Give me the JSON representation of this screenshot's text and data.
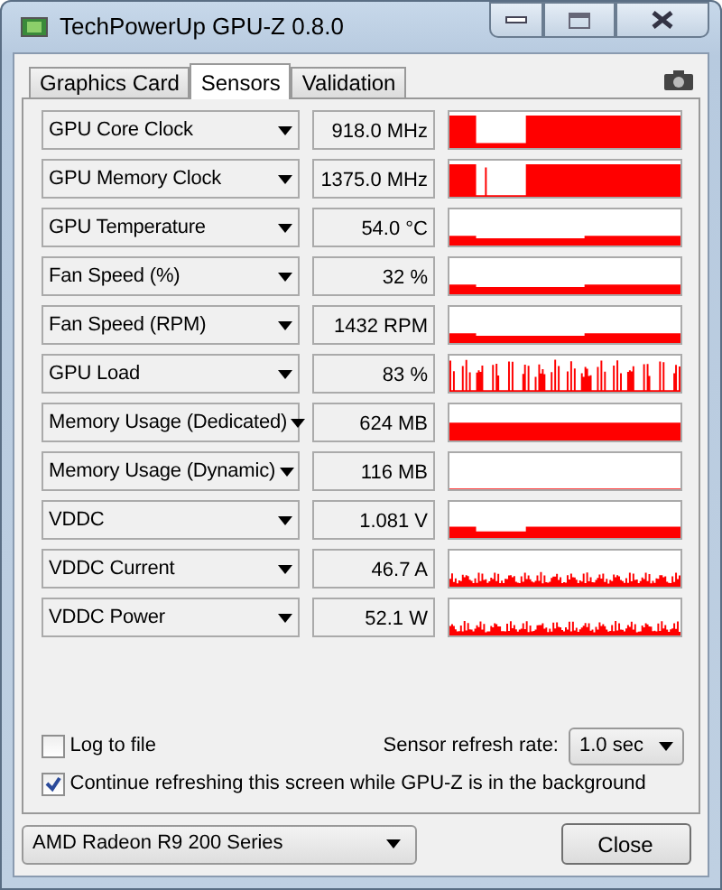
{
  "window": {
    "title": "TechPowerUp GPU-Z 0.8.0"
  },
  "tabs": [
    {
      "label": "Graphics Card",
      "selected": false
    },
    {
      "label": "Sensors",
      "selected": true
    },
    {
      "label": "Validation",
      "selected": false
    }
  ],
  "sensors": [
    {
      "name": "GPU Core Clock",
      "value": "918.0 MHz"
    },
    {
      "name": "GPU Memory Clock",
      "value": "1375.0 MHz"
    },
    {
      "name": "GPU Temperature",
      "value": "54.0 °C"
    },
    {
      "name": "Fan Speed (%)",
      "value": "32 %"
    },
    {
      "name": "Fan Speed (RPM)",
      "value": "1432 RPM"
    },
    {
      "name": "GPU Load",
      "value": "83 %"
    },
    {
      "name": "Memory Usage (Dedicated)",
      "value": "624 MB"
    },
    {
      "name": "Memory Usage (Dynamic)",
      "value": "116 MB"
    },
    {
      "name": "VDDC",
      "value": "1.081 V"
    },
    {
      "name": "VDDC Current",
      "value": "46.7 A"
    },
    {
      "name": "VDDC Power",
      "value": "52.1 W"
    }
  ],
  "options": [
    {
      "label": "Log to file",
      "checked": false
    },
    {
      "label": "Continue refreshing this screen while GPU-Z is in the background",
      "checked": true
    }
  ],
  "refresh_rate": {
    "label": "Sensor refresh rate:",
    "value": "1.0 sec"
  },
  "gpu_select": {
    "value": "AMD Radeon R9 200 Series"
  },
  "close_button": "Close"
}
